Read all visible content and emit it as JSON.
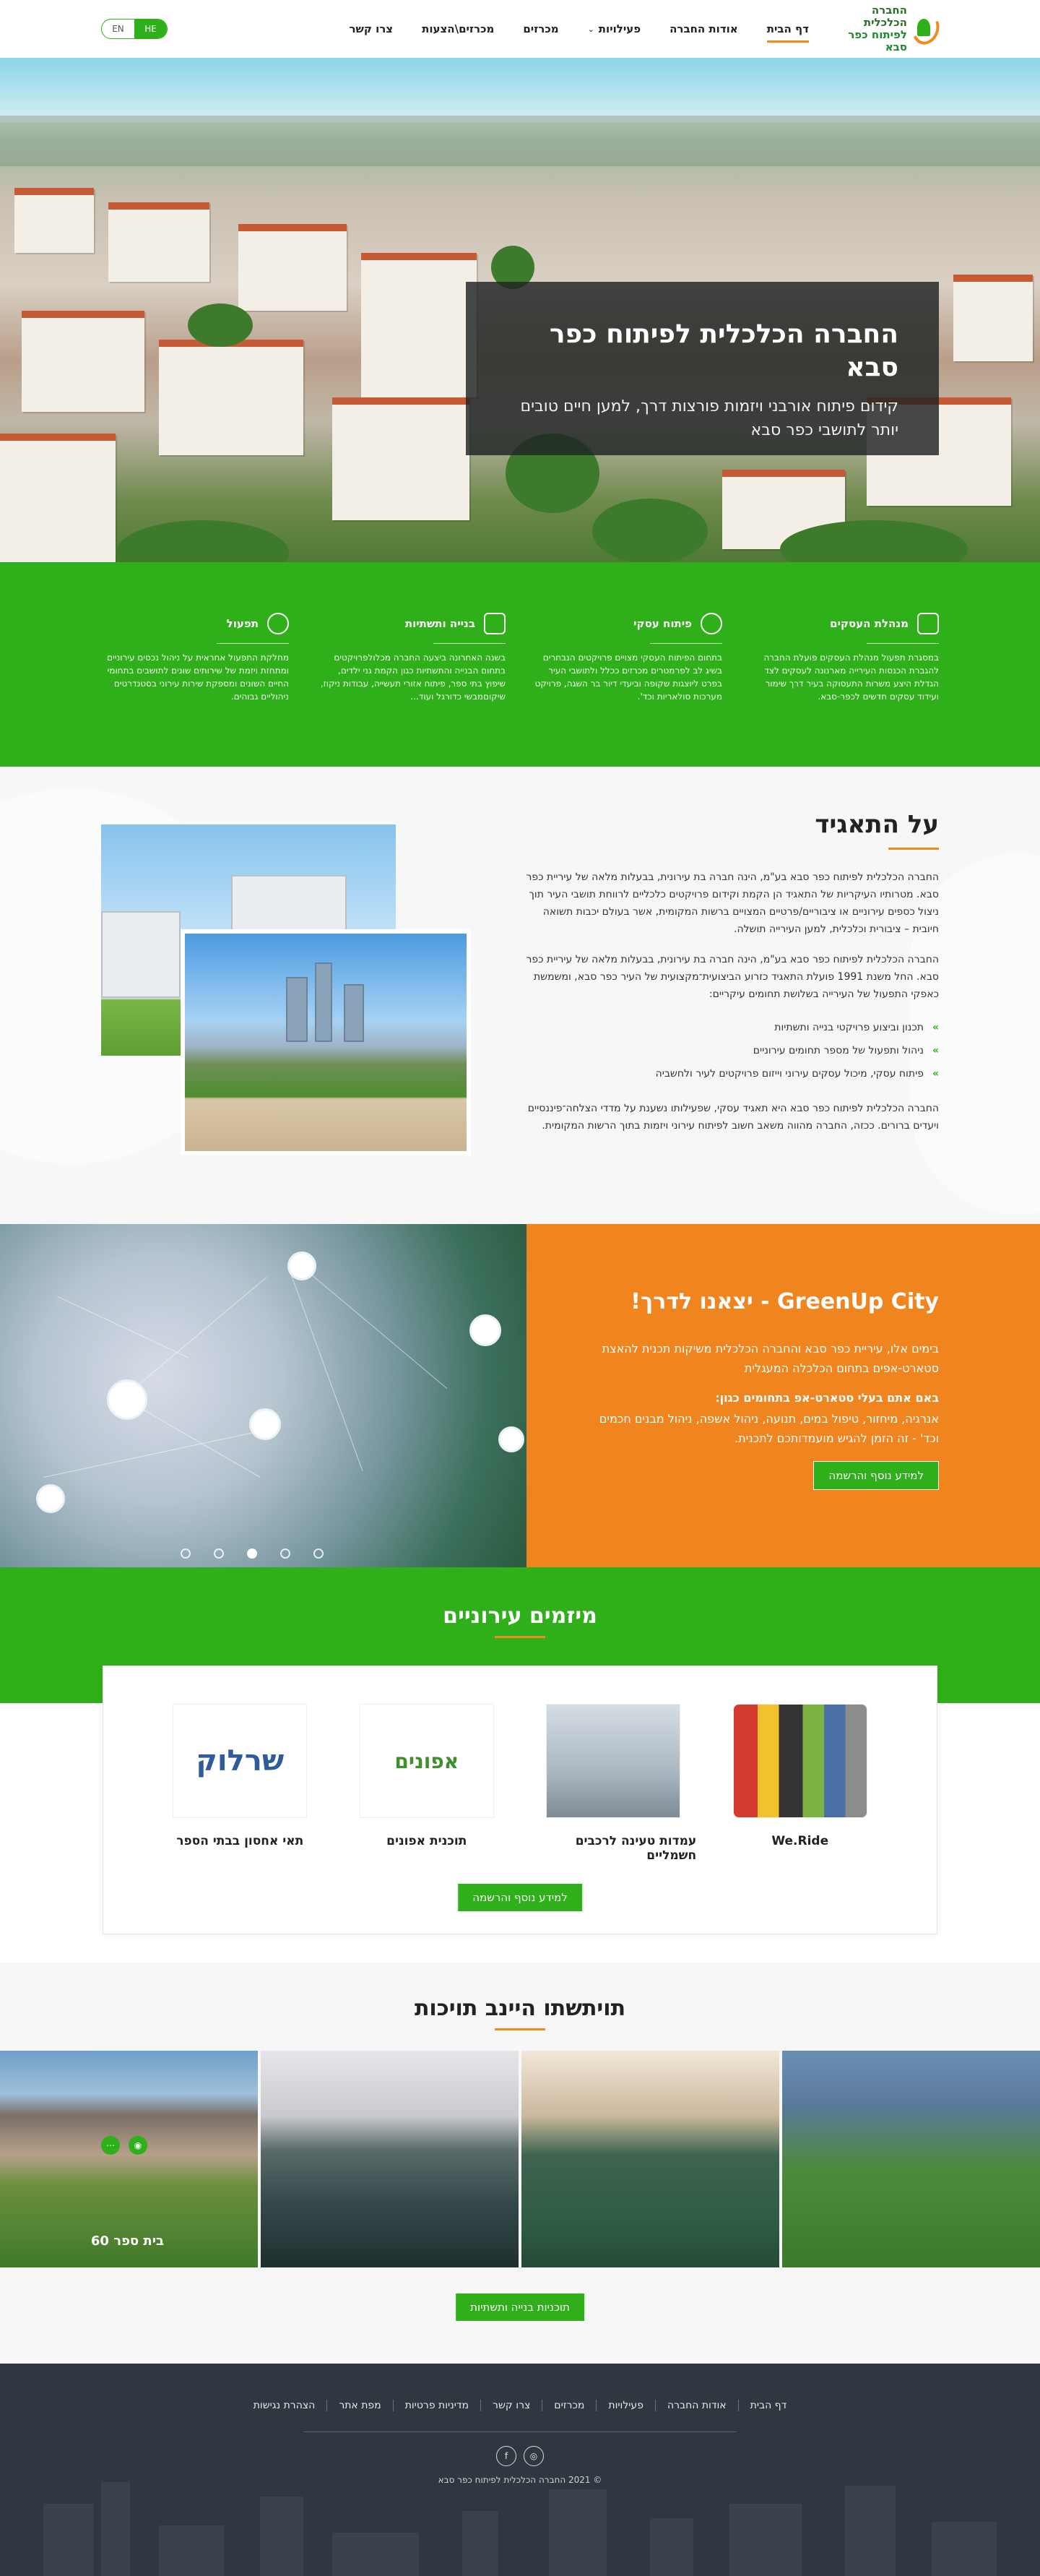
{
  "header": {
    "logo_line1": "החברה הכלכלית",
    "logo_line2": "לפיתוח כפר סבא",
    "nav": [
      {
        "label": "דף הבית",
        "active": true
      },
      {
        "label": "אודות החברה"
      },
      {
        "label": "פעילויות",
        "has_dropdown": true
      },
      {
        "label": "מכרזים"
      },
      {
        "label": "מכרזים\\הצעות"
      },
      {
        "label": "צרו קשר"
      }
    ],
    "lang_he": "HE",
    "lang_en": "EN"
  },
  "hero": {
    "title": "החברה הכלכלית לפיתוח כפר סבא",
    "subtitle": "קידום פיתוח אורבני ויזמות פורצות דרך, למען חיים טובים יותר לתושבי כפר סבא"
  },
  "services": [
    {
      "icon": "briefcase-icon",
      "title": "מנהלת העסקים",
      "text": "במסגרת תפעול מנהלת העסקים פועלת החברה להגברת הכנסות העירייה מארנונה לעסקים לצד הגדלת היצע משרות התעסוקה בעיר דרך שימור ועידוד עסקים חדשים לכפר-סבא."
    },
    {
      "icon": "lightbulb-icon",
      "title": "פיתוח עסקי",
      "text": "בתחום הפיתוח העסקי מצויים פרויקטים הנבחרים בשיג לב לפרמטרים מכרזים ככלל ולתושבי העיר בפרט ליוצגות שקופה וביעדי דיור בר השגה, פרויקט מערכות סולאריות וכד'."
    },
    {
      "icon": "crane-icon",
      "title": "בנייה ותשתיות",
      "text": "בשנה האחרונה ביצעה החברה מכלולפרויקטים בתחום הבנייה והתשתיות כגון הקמת גני ילדים, שיפוץ בתי ספר, פיתוח אזורי תעשייה, עבודות ניקוז, שיקוםמבשי כדורגל ועוד..."
    },
    {
      "icon": "maintenance-icon",
      "title": "תפעול",
      "text": "מחלקת התפעול אחראית על ניהול נכסים עירוניים ומתחזת ויזמת של שירותים שונים לתושבים בתחומי החיים השונים ומספקת שירות עירוני בסטנדרטים ניהוליים גבוהים."
    }
  ],
  "about": {
    "title": "על התאגיד",
    "p1": "החברה הכלכלית לפיתוח כפר סבא בע\"מ, הינה חברה בת עירונית, בבעלות מלאה של עיריית כפר סבא. מטרותיו העיקריות של התאגיד הן הקמת וקידום פרויקטים כלכליים לרווחת תושבי העיר תוך ניצול כספים עירוניים או ציבוריים/פרטיים המצויים ברשות המקומית, אשר בעולם יכבות תשואה חיובית – ציבורית וכלכלית, למען העירייה תושלה.",
    "p2": "החברה הכלכלית לפיתוח כפר סבא בע\"מ, הינה חברה בת עירונית, בבעלות מלאה של עיריית כפר סבא. החל משנת 1991 פועלת התאגיד כזרוע הביצועית־מקצועית של העיר כפר סבא, ומשמשת כאפקי התפעול של העירייה בשלושת תחומים עיקריים:",
    "list": [
      "תכנון וביצוע פרויקטי בנייה ותשתיות",
      "ניהול ותפעול של מספר תחומים עירוניים",
      "פיתוח עסקי, מיכול עסקים עירוני וייזום פרויקטים לעיר ולחשביה"
    ],
    "p3": "החברה הכלכלית לפיתוח כפר סבא היא תאגיד עסקי, שפעילותו נשענת על מדדי הצלחה־פיננסיים ויעדים ברורים. ככזה, החברה מהווה משאב חשוב לפיתוח עירוני ויזמות בתוך הרשות המקומית."
  },
  "greenup": {
    "title": "GreenUp City - יצאנו לדרך!",
    "p1": "בימים אלו, עיריית כפר סבא והחברה הכלכלית משיקות תכנית להאצת סטארט-אפים בתחום הכלכלה המעגלית",
    "subtitle": "באם אתם בעלי סטארט-אפ בתחומים כגון:",
    "p2": "אנרגיה, מיחזור, טיפול במים, תנועה, ניהול אשפה, ניהול מבנים חכמים וכד' - זה הזמן להגיש מועמדותכם לתכנית.",
    "button": "למידע נוסף והרשמה",
    "slides": 5,
    "active_slide": 2
  },
  "initiatives": {
    "title": "מיזמים עירוניים",
    "items": [
      {
        "name": "We.Ride",
        "logo": "weride-logo"
      },
      {
        "name": "עמדות טעינה לרכבים חשמליים",
        "logo": "ev-charging-logo"
      },
      {
        "name": "תוכנית אפונים",
        "logo": "afunim-logo",
        "logo_text": "אפונים"
      },
      {
        "name": "תאי אחסון בבתי הספר",
        "logo": "sharlock-logo",
        "logo_text": "שרלוק"
      }
    ],
    "button": "למידע נוסף והרשמה"
  },
  "projects": {
    "title": "תויתשתו היינב תויכות",
    "gallery": [
      {
        "caption": ""
      },
      {
        "caption": ""
      },
      {
        "caption": ""
      },
      {
        "caption": "בית ספר 60"
      }
    ],
    "button": "תוכניות בנייה ותשתיות"
  },
  "footer": {
    "nav": [
      "דף הבית",
      "אודות החברה",
      "פעילויות",
      "מכרזים",
      "צרו קשר",
      "מדיניות פרטיות",
      "מפת אתר",
      "הצהרת נגישות"
    ],
    "socials": [
      "instagram-icon",
      "facebook-icon"
    ],
    "copyright": "© 2021 החברה הכלכלית לפיתוח כפר סבא"
  },
  "colors": {
    "green": "#2fb01a",
    "orange": "#f0851f",
    "dark": "#2f3740"
  }
}
